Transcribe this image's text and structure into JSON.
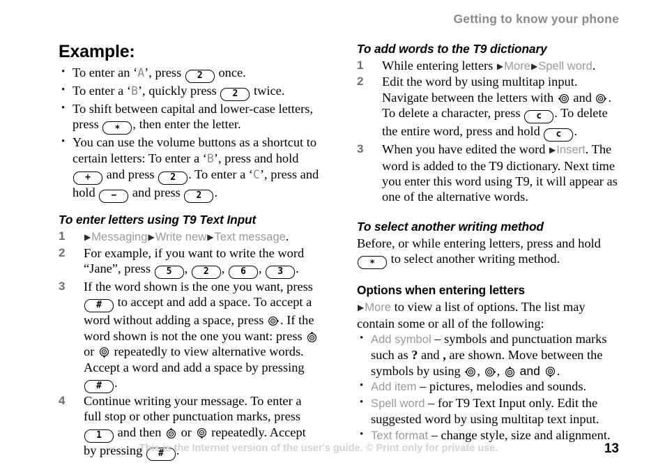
{
  "header": {
    "title": "Getting to know your phone"
  },
  "footer": {
    "note": "This is the Internet version of the user's guide. © Print only for private use.",
    "page_number": "13"
  },
  "left_column": {
    "example": {
      "title": "Example:",
      "bullets": [
        {
          "id": "enter-a",
          "parts": [
            {
              "t": "text",
              "v": "To enter an ‘"
            },
            {
              "t": "lcd",
              "v": "A"
            },
            {
              "t": "text",
              "v": "’, press "
            },
            {
              "t": "key",
              "v": "2"
            },
            {
              "t": "text",
              "v": " once."
            }
          ]
        },
        {
          "id": "enter-b",
          "parts": [
            {
              "t": "text",
              "v": "To enter a ‘"
            },
            {
              "t": "lcd",
              "v": "B"
            },
            {
              "t": "text",
              "v": "’, quickly press "
            },
            {
              "t": "key",
              "v": "2"
            },
            {
              "t": "text",
              "v": " twice."
            }
          ]
        },
        {
          "id": "shift-case",
          "parts": [
            {
              "t": "text",
              "v": "To shift between capital and lower-case letters, press "
            },
            {
              "t": "key",
              "v": "∗"
            },
            {
              "t": "text",
              "v": ", then enter the letter."
            }
          ]
        },
        {
          "id": "volume-shortcut",
          "parts": [
            {
              "t": "text",
              "v": "You can use the volume buttons as a shortcut to certain letters: To enter a ‘"
            },
            {
              "t": "lcd",
              "v": "B"
            },
            {
              "t": "text",
              "v": "’, press and hold "
            },
            {
              "t": "key",
              "v": "+"
            },
            {
              "t": "text",
              "v": " and press "
            },
            {
              "t": "key",
              "v": "2"
            },
            {
              "t": "text",
              "v": ". To enter a ‘"
            },
            {
              "t": "lcd",
              "v": "C"
            },
            {
              "t": "text",
              "v": "’, press and hold "
            },
            {
              "t": "key",
              "v": "−"
            },
            {
              "t": "text",
              "v": " and press "
            },
            {
              "t": "key",
              "v": "2"
            },
            {
              "t": "text",
              "v": "."
            }
          ]
        }
      ]
    },
    "t9_input": {
      "title": "To enter letters using T9 Text Input",
      "steps": [
        {
          "num": "1",
          "parts": [
            {
              "t": "arrow"
            },
            {
              "t": "menu",
              "v": "Messaging"
            },
            {
              "t": "arrow"
            },
            {
              "t": "menu",
              "v": "Write new"
            },
            {
              "t": "arrow"
            },
            {
              "t": "menu",
              "v": "Text message"
            },
            {
              "t": "text",
              "v": "."
            }
          ]
        },
        {
          "num": "2",
          "parts": [
            {
              "t": "text",
              "v": "For example, if you want to write the word “Jane”, press "
            },
            {
              "t": "key",
              "v": "5"
            },
            {
              "t": "text",
              "v": ", "
            },
            {
              "t": "key",
              "v": "2"
            },
            {
              "t": "text",
              "v": ", "
            },
            {
              "t": "key",
              "v": "6"
            },
            {
              "t": "text",
              "v": ", "
            },
            {
              "t": "key",
              "v": "3"
            },
            {
              "t": "text",
              "v": "."
            }
          ]
        },
        {
          "num": "3",
          "parts": [
            {
              "t": "text",
              "v": "If the word shown is the one you want, press "
            },
            {
              "t": "key",
              "v": "#"
            },
            {
              "t": "text",
              "v": " to accept and add a space. To accept a word without adding a space, press "
            },
            {
              "t": "nav",
              "v": "right"
            },
            {
              "t": "text",
              "v": ". If the word shown is not the one you want: press "
            },
            {
              "t": "nav",
              "v": "up"
            },
            {
              "t": "text",
              "v": " or "
            },
            {
              "t": "nav",
              "v": "down"
            },
            {
              "t": "text",
              "v": " repeatedly to view alternative words. Accept a word and add a space by pressing "
            },
            {
              "t": "key",
              "v": "#"
            },
            {
              "t": "text",
              "v": "."
            }
          ]
        },
        {
          "num": "4",
          "parts": [
            {
              "t": "text",
              "v": "Continue writing your message. To enter a full stop or other punctuation marks, press "
            },
            {
              "t": "key",
              "v": "1"
            },
            {
              "t": "text",
              "v": " and then "
            },
            {
              "t": "nav",
              "v": "up"
            },
            {
              "t": "text",
              "v": " or "
            },
            {
              "t": "nav",
              "v": "down"
            },
            {
              "t": "text",
              "v": " repeatedly. Accept by pressing "
            },
            {
              "t": "key",
              "v": "#"
            },
            {
              "t": "text",
              "v": "."
            }
          ]
        }
      ]
    }
  },
  "right_column": {
    "add_words": {
      "title": "To add words to the T9 dictionary",
      "steps": [
        {
          "num": "1",
          "parts": [
            {
              "t": "text",
              "v": "While entering letters "
            },
            {
              "t": "arrow"
            },
            {
              "t": "menu",
              "v": "More"
            },
            {
              "t": "arrow"
            },
            {
              "t": "menu",
              "v": "Spell word"
            },
            {
              "t": "text",
              "v": "."
            }
          ]
        },
        {
          "num": "2",
          "parts": [
            {
              "t": "text",
              "v": "Edit the word by using multitap input. Navigate between the letters with "
            },
            {
              "t": "nav",
              "v": "left"
            },
            {
              "t": "text",
              "v": " and "
            },
            {
              "t": "nav",
              "v": "right"
            },
            {
              "t": "text",
              "v": ". To delete a character, press "
            },
            {
              "t": "key",
              "v": "c"
            },
            {
              "t": "text",
              "v": ". To delete the entire word, press and hold "
            },
            {
              "t": "key",
              "v": "c"
            },
            {
              "t": "text",
              "v": "."
            }
          ]
        },
        {
          "num": "3",
          "parts": [
            {
              "t": "text",
              "v": "When you have edited the word "
            },
            {
              "t": "arrow"
            },
            {
              "t": "menu",
              "v": "Insert"
            },
            {
              "t": "text",
              "v": ". The word is added to the T9 dictionary. Next time you enter this word using T9, it will appear as one of the alternative words."
            }
          ]
        }
      ]
    },
    "writing_method": {
      "title": "To select another writing method",
      "paragraph": [
        {
          "t": "text",
          "v": "Before, or while entering letters, press and hold "
        },
        {
          "t": "key",
          "v": "∗"
        },
        {
          "t": "text",
          "v": " to select another writing method."
        }
      ]
    },
    "options": {
      "title": "Options when entering letters",
      "intro": [
        {
          "t": "arrow"
        },
        {
          "t": "menu",
          "v": "More"
        },
        {
          "t": "text",
          "v": " to view a list of options. The list may contain some or all of the following:"
        }
      ],
      "bullets": [
        {
          "id": "add-symbol",
          "parts": [
            {
              "t": "menu",
              "v": "Add symbol"
            },
            {
              "t": "text",
              "v": " – symbols and punctuation marks such as "
            },
            {
              "t": "bold",
              "v": "?"
            },
            {
              "t": "text",
              "v": " and "
            },
            {
              "t": "bold",
              "v": ","
            },
            {
              "t": "text",
              "v": " are shown. Move between the symbols by using "
            },
            {
              "t": "nav",
              "v": "left"
            },
            {
              "t": "text",
              "v": ", "
            },
            {
              "t": "nav",
              "v": "right"
            },
            {
              "t": "text",
              "v": ", "
            },
            {
              "t": "nav",
              "v": "up"
            },
            {
              "t": "sans",
              "v": " and "
            },
            {
              "t": "nav",
              "v": "down"
            },
            {
              "t": "text",
              "v": "."
            }
          ]
        },
        {
          "id": "add-item",
          "parts": [
            {
              "t": "menu",
              "v": "Add item"
            },
            {
              "t": "text",
              "v": " – pictures, melodies and sounds."
            }
          ]
        },
        {
          "id": "spell-word",
          "parts": [
            {
              "t": "menu",
              "v": "Spell word"
            },
            {
              "t": "text",
              "v": " – for T9 Text Input only. Edit the suggested word by using multitap text input."
            }
          ]
        },
        {
          "id": "text-format",
          "parts": [
            {
              "t": "menu",
              "v": "Text format"
            },
            {
              "t": "text",
              "v": " – change style, size and alignment."
            }
          ]
        }
      ]
    }
  },
  "colors": {
    "header_gray": "#8b8b8b",
    "menu_gray": "#9a9a9a",
    "step_number_gray": "#6e6e6e",
    "footer_gray": "#d2d2d2",
    "lcd_letter_gray": "#8d8d8d",
    "text_black": "#000000"
  }
}
